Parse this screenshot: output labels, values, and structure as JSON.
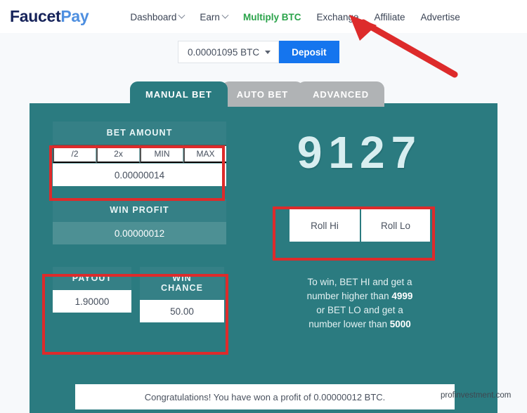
{
  "nav": {
    "logo_primary": "Faucet",
    "logo_secondary": "Pay",
    "items": [
      {
        "label": "Dashboard",
        "has_caret": true,
        "active": false
      },
      {
        "label": "Earn",
        "has_caret": true,
        "active": false
      },
      {
        "label": "Multiply BTC",
        "has_caret": false,
        "active": true
      },
      {
        "label": "Exchange",
        "has_caret": false,
        "active": false
      },
      {
        "label": "Affiliate",
        "has_caret": false,
        "active": false
      },
      {
        "label": "Advertise",
        "has_caret": false,
        "active": false
      }
    ],
    "active_color": "#2aa34a"
  },
  "account": {
    "balance": "0.00001095 BTC",
    "deposit_label": "Deposit",
    "deposit_color": "#1575ee"
  },
  "tabs": [
    {
      "label": "MANUAL BET",
      "active": true
    },
    {
      "label": "AUTO BET",
      "active": false
    },
    {
      "label": "ADVANCED",
      "active": false
    }
  ],
  "bet": {
    "amount_label": "BET AMOUNT",
    "quick_buttons": [
      "/2",
      "2x",
      "MIN",
      "MAX"
    ],
    "amount_value": "0.00000014",
    "profit_label": "WIN PROFIT",
    "profit_value": "0.00000012",
    "payout_label": "PAYOUT",
    "payout_value": "1.90000",
    "chance_label_line1": "WIN",
    "chance_label_line2": "CHANCE",
    "chance_value": "50.00"
  },
  "roll": {
    "result": "9127",
    "hi_label": "Roll Hi",
    "lo_label": "Roll Lo",
    "hint_line1": "To win, BET HI and get a",
    "hint_line2_pre": "number higher than ",
    "hint_line2_num": "4999",
    "hint_line3": "or BET LO and get a",
    "hint_line4_pre": "number lower than ",
    "hint_line4_num": "5000"
  },
  "status": {
    "message": "Congratulations! You have won a profit of 0.00000012 BTC."
  },
  "theme": {
    "panel_color": "#2b7b80",
    "annotation_color": "#dd2b2b"
  },
  "watermark": "profinvestment.com"
}
